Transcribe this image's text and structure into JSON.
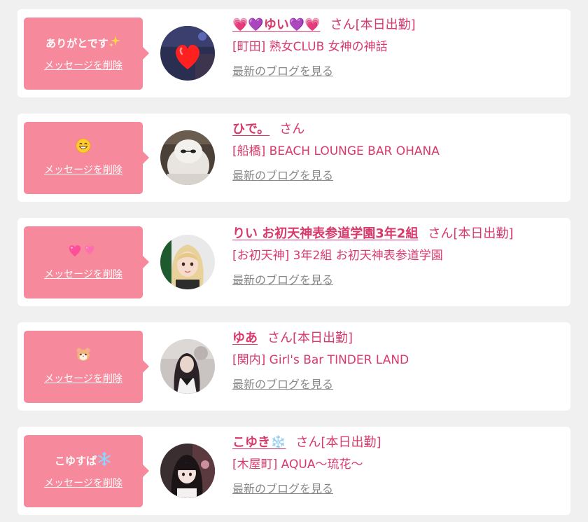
{
  "messages": [
    {
      "message_text": "ありがとです",
      "message_emoji": "sparkles-icon",
      "delete_label": "メッセージを削除",
      "name": "💗💜ゆい💜💗",
      "name_suffix": "さん[本日出勤]",
      "shop": "[町田] 熟女CLUB 女神の神話",
      "blog_link": "最新のブログを見る",
      "avatar": "heart-sticker-photo"
    },
    {
      "message_text": "",
      "message_emoji": "grinning-face-icon",
      "delete_label": "メッセージを削除",
      "name": "ひで。",
      "name_suffix": "さん",
      "shop": "[船橋] BEACH LOUNGE BAR OHANA",
      "blog_link": "最新のブログを見る",
      "avatar": "plush-toy-photo"
    },
    {
      "message_text": "",
      "message_emoji": "two-hearts-icon",
      "delete_label": "メッセージを削除",
      "name": "りい お初天神表参道学園3年2組",
      "name_suffix": "さん[本日出勤]",
      "shop": "[お初天神] 3年2組 お初天神表参道学園",
      "blog_link": "最新のブログを見る",
      "avatar": "blonde-girl-photo"
    },
    {
      "message_text": "",
      "message_emoji": "hamster-icon",
      "delete_label": "メッセージを削除",
      "name": "ゆあ",
      "name_suffix": "さん[本日出勤]",
      "shop": "[関内] Girl's Bar TINDER LAND",
      "blog_link": "最新のブログを見る",
      "avatar": "girl-photo"
    },
    {
      "message_text": "こゆすぱ",
      "message_emoji": "snowflake-icon",
      "delete_label": "メッセージを削除",
      "name": "こゆき❄️",
      "name_suffix": "さん[本日出勤]",
      "shop": "[木屋町] AQUA〜琉花〜",
      "blog_link": "最新のブログを見る",
      "avatar": "girl-with-bangs-photo"
    }
  ],
  "colors": {
    "bubble": "#f7899c",
    "accent": "#d83a6c",
    "link_gray": "#888888",
    "background": "#f0f0f0"
  }
}
